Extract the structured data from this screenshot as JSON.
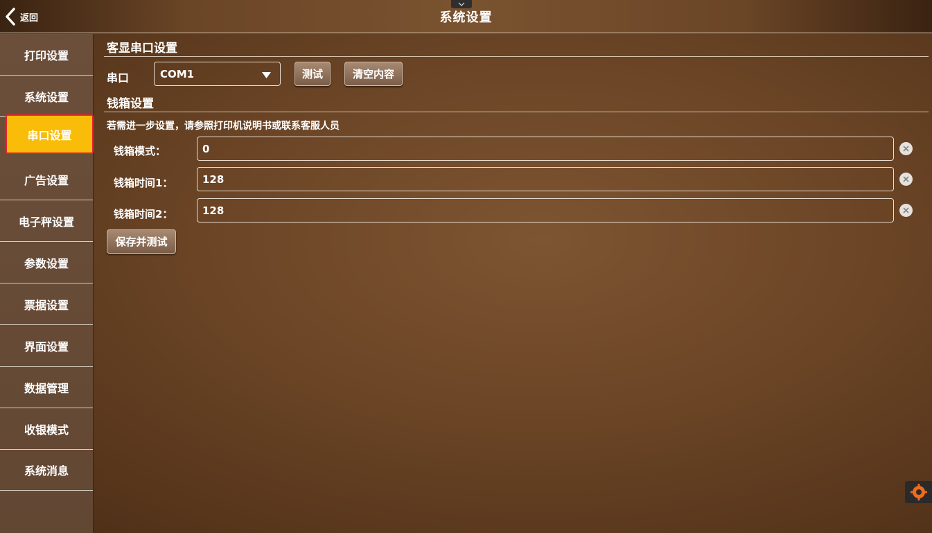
{
  "header": {
    "back_label": "返回",
    "title": "系统设置"
  },
  "sidebar": {
    "items": [
      {
        "label": "打印设置"
      },
      {
        "label": "系统设置"
      },
      {
        "label": "串口设置",
        "active": true
      },
      {
        "label": "广告设置"
      },
      {
        "label": "电子秤设置"
      },
      {
        "label": "参数设置"
      },
      {
        "label": "票据设置"
      },
      {
        "label": "界面设置"
      },
      {
        "label": "数据管理"
      },
      {
        "label": "收银模式"
      },
      {
        "label": "系统消息"
      }
    ]
  },
  "serial": {
    "section_title": "客显串口设置",
    "port_label": "串口",
    "port_value": "COM1",
    "test_button": "测试",
    "clear_button": "清空内容"
  },
  "cashbox": {
    "section_title": "钱箱设置",
    "note": "若需进一步设置，请参照打印机说明书或联系客服人员",
    "rows": [
      {
        "label": "钱箱模式：",
        "value": "0"
      },
      {
        "label": "钱箱时间1：",
        "value": "128"
      },
      {
        "label": "钱箱时间2：",
        "value": "128"
      }
    ],
    "save_button": "保存并测试"
  },
  "colors": {
    "active_tab": "#f9bd09",
    "highlight_border": "#e8222a",
    "background": "#6a4425"
  },
  "icons": [
    "back-arrow-icon",
    "chevron-down-icon",
    "dropdown-arrow-icon",
    "clear-icon",
    "app-widget-icon"
  ]
}
